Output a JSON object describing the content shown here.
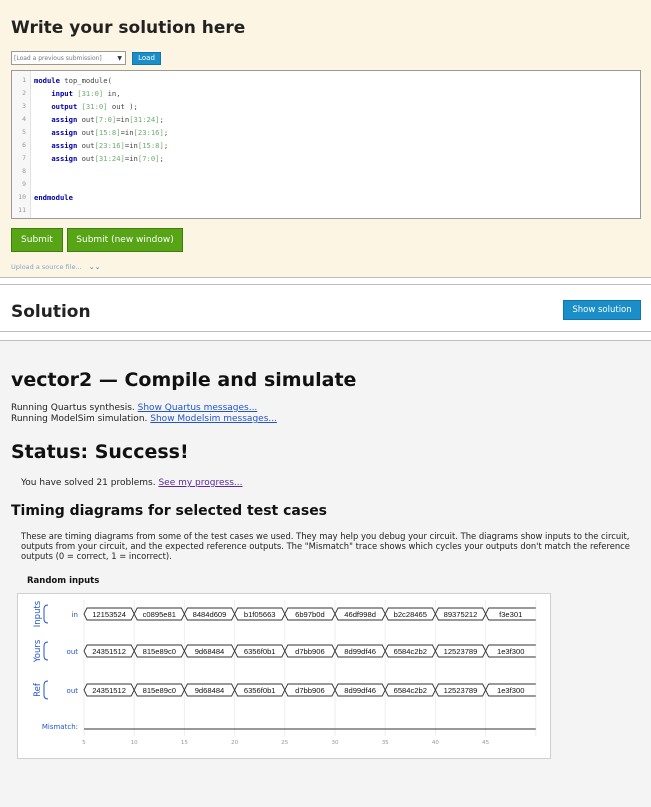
{
  "write_panel": {
    "title": "Write your solution here",
    "history_placeholder": "[Load a previous submission]",
    "load_button": "Load",
    "code_lines": [
      {
        "num": "1",
        "tokens": [
          {
            "t": "module",
            "c": "kw"
          },
          {
            "t": " top_module(",
            "c": ""
          }
        ]
      },
      {
        "num": "2",
        "tokens": [
          {
            "t": "    ",
            "c": ""
          },
          {
            "t": "input",
            "c": "kw"
          },
          {
            "t": " ",
            "c": ""
          },
          {
            "t": "[31:0]",
            "c": "num"
          },
          {
            "t": " in,",
            "c": ""
          }
        ]
      },
      {
        "num": "3",
        "tokens": [
          {
            "t": "    ",
            "c": ""
          },
          {
            "t": "output",
            "c": "kw"
          },
          {
            "t": " ",
            "c": ""
          },
          {
            "t": "[31:0]",
            "c": "num"
          },
          {
            "t": " out );",
            "c": ""
          }
        ]
      },
      {
        "num": "4",
        "tokens": [
          {
            "t": "    ",
            "c": ""
          },
          {
            "t": "assign",
            "c": "kw"
          },
          {
            "t": " out",
            "c": ""
          },
          {
            "t": "[7:0]",
            "c": "num"
          },
          {
            "t": "=in",
            "c": ""
          },
          {
            "t": "[31:24]",
            "c": "num"
          },
          {
            "t": ";",
            "c": ""
          }
        ]
      },
      {
        "num": "5",
        "tokens": [
          {
            "t": "    ",
            "c": ""
          },
          {
            "t": "assign",
            "c": "kw"
          },
          {
            "t": " out",
            "c": ""
          },
          {
            "t": "[15:8]",
            "c": "num"
          },
          {
            "t": "=in",
            "c": ""
          },
          {
            "t": "[23:16]",
            "c": "num"
          },
          {
            "t": ";",
            "c": ""
          }
        ]
      },
      {
        "num": "6",
        "tokens": [
          {
            "t": "    ",
            "c": ""
          },
          {
            "t": "assign",
            "c": "kw"
          },
          {
            "t": " out",
            "c": ""
          },
          {
            "t": "[23:16]",
            "c": "num"
          },
          {
            "t": "=in",
            "c": ""
          },
          {
            "t": "[15:8]",
            "c": "num"
          },
          {
            "t": ";",
            "c": ""
          }
        ]
      },
      {
        "num": "7",
        "tokens": [
          {
            "t": "    ",
            "c": ""
          },
          {
            "t": "assign",
            "c": "kw"
          },
          {
            "t": " out",
            "c": ""
          },
          {
            "t": "[31:24]",
            "c": "num"
          },
          {
            "t": "=in",
            "c": ""
          },
          {
            "t": "[7:0]",
            "c": "num"
          },
          {
            "t": ";",
            "c": ""
          }
        ]
      },
      {
        "num": "8",
        "tokens": []
      },
      {
        "num": "9",
        "tokens": []
      },
      {
        "num": "10",
        "tokens": [
          {
            "t": "endmodule",
            "c": "kw"
          }
        ]
      },
      {
        "num": "11",
        "tokens": []
      }
    ],
    "submit_button": "Submit",
    "submit_new_window_button": "Submit (new window)",
    "upload_link": "Upload a source file..."
  },
  "solution_panel": {
    "title": "Solution",
    "show_button": "Show solution"
  },
  "results": {
    "title": "vector2 — Compile and simulate",
    "quartus_text": "Running Quartus synthesis.",
    "quartus_link": "Show Quartus messages...",
    "modelsim_text": "Running ModelSim simulation.",
    "modelsim_link": "Show Modelsim messages...",
    "status": "Status: Success!",
    "solved_text": "You have solved 21 problems.",
    "progress_link": "See my progress...",
    "timing_title": "Timing diagrams for selected test cases",
    "timing_desc": "These are timing diagrams from some of the test cases we used. They may help you debug your circuit. The diagrams show inputs to the circuit, outputs from your circuit, and the expected reference outputs. The \"Mismatch\" trace shows which cycles your outputs don't match the reference outputs (0 = correct, 1 = incorrect).",
    "random_inputs_label": "Random inputs"
  },
  "timing": {
    "groups": [
      {
        "group": "Inputs",
        "signal": "in",
        "values": [
          "12153524",
          "c0895e81",
          "8484d609",
          "b1f05663",
          "6b97b0d",
          "46df998d",
          "b2c28465",
          "89375212",
          "f3e301"
        ]
      },
      {
        "group": "Yours",
        "signal": "out",
        "values": [
          "24351512",
          "815e89c0",
          "9d68484",
          "6356f0b1",
          "d7bb906",
          "8d99df46",
          "6584c2b2",
          "12523789",
          "1e3f300"
        ]
      },
      {
        "group": "Ref",
        "signal": "out",
        "values": [
          "24351512",
          "815e89c0",
          "9d68484",
          "6356f0b1",
          "d7bb906",
          "8d99df46",
          "6584c2b2",
          "12523789",
          "1e3f300"
        ]
      }
    ],
    "mismatch_label": "Mismatch:",
    "ticks": [
      "5",
      "10",
      "15",
      "20",
      "25",
      "30",
      "35",
      "40",
      "45"
    ]
  },
  "colors": {
    "write_bg": "#fdf5e3",
    "accent_blue": "#1a8ec9",
    "green": "#57a416",
    "link": "#2255cc",
    "visited_link": "#5a2a99"
  },
  "icons": {
    "dropdown": "chevron-down-icon",
    "upload_toggle": "double-chevron-down-icon"
  }
}
